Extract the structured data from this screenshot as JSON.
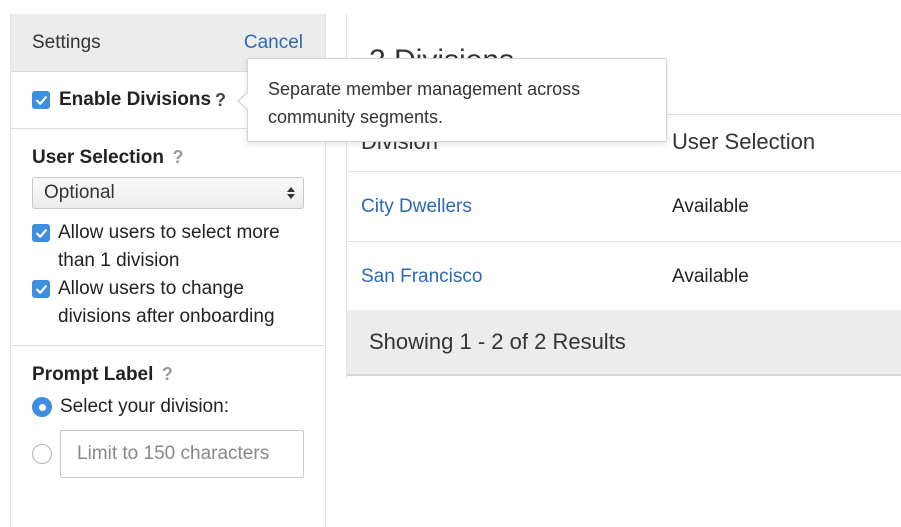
{
  "settings": {
    "title": "Settings",
    "cancel_label": "Cancel",
    "enable_divisions": {
      "label": "Enable Divisions",
      "help": "?",
      "checked": true
    },
    "user_selection": {
      "label": "User Selection",
      "help": "?",
      "selected_option": "Optional",
      "options": [
        {
          "label": "Allow users to select more than 1 division",
          "checked": true
        },
        {
          "label": "Allow users to change divisions after onboarding",
          "checked": true
        }
      ]
    },
    "prompt_label": {
      "label": "Prompt Label",
      "help": "?",
      "radio_default_label": "Select your division:",
      "radio_default_selected": true,
      "custom_placeholder": "Limit to 150 characters"
    }
  },
  "main": {
    "heading": "2 Divisions",
    "columns": [
      "Division",
      "User Selection"
    ],
    "rows": [
      {
        "division": "City Dwellers",
        "selection": "Available"
      },
      {
        "division": "San Francisco",
        "selection": "Available"
      }
    ],
    "footer": "Showing 1 - 2 of 2 Results"
  },
  "tooltip": {
    "text": "Separate member management across community segments."
  },
  "colors": {
    "accent": "#3d8ee0",
    "link": "#2a6ab4",
    "header_bg": "#ececec"
  }
}
